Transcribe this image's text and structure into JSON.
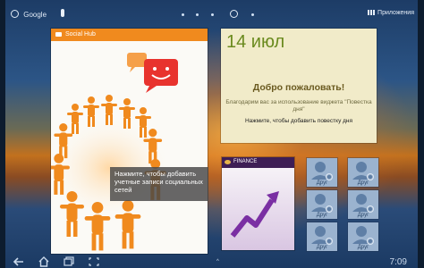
{
  "topbar": {
    "search_label": "Google",
    "apps_label": "Приложения"
  },
  "social_hub": {
    "title": "Social Hub",
    "tip": "Нажмите, чтобы добавить учетные записи социальных сетей"
  },
  "agenda": {
    "date": "14 июл",
    "welcome": "Добро пожаловать!",
    "description": "Благодарим вас за использование виджета \"Повестка дня\"",
    "hint": "Нажмите, чтобы добавить повестку дня"
  },
  "finance": {
    "label": "FINANCE"
  },
  "contacts": [
    {
      "name": "Друг"
    },
    {
      "name": "Друг"
    },
    {
      "name": "Друг"
    },
    {
      "name": "Друг"
    },
    {
      "name": "Друг"
    },
    {
      "name": "Друг"
    }
  ],
  "statusbar": {
    "time": "7:09",
    "up_label": "^"
  },
  "colors": {
    "social_header": "#f08a1e",
    "agenda_date": "#6a8a1e",
    "finance_header": "#3e1e55"
  }
}
